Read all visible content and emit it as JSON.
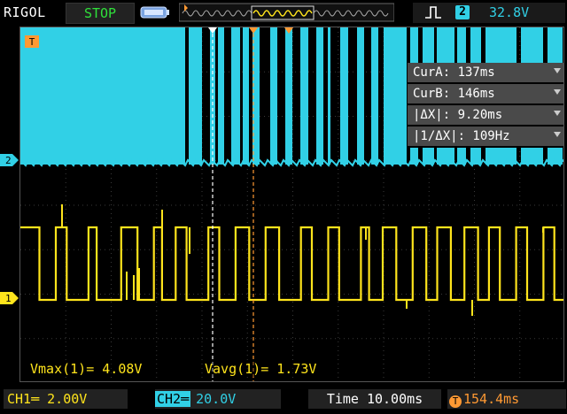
{
  "header": {
    "brand": "RIGOL",
    "run_state": "STOP",
    "trigger_source_channel": "2",
    "trigger_level": "32.8V"
  },
  "cursor_readout": {
    "cur_a": "CurA: 137ms",
    "cur_b": "CurB: 146ms",
    "delta_x": "|ΔX|: 9.20ms",
    "inv_delta_x": "|1/ΔX|: 109Hz"
  },
  "measurements": {
    "vmax": "Vmax(1)= 4.08V",
    "vavg": "Vavg(1)= 1.73V"
  },
  "footer": {
    "ch1_scale": "CH1═  2.00V",
    "ch2_label": "CH2═",
    "ch2_scale": "20.0V",
    "timebase": "Time 10.00ms",
    "trigger_offset": "154.4ms"
  },
  "markers": {
    "ch1": "1",
    "ch2": "2",
    "trigger": "T"
  },
  "chart_data": {
    "type": "line",
    "series": [
      {
        "name": "CH1",
        "color": "#ffe41c",
        "scale_per_div": "2.00V",
        "edges_ms": [
          0,
          7,
          13,
          17,
          25,
          28,
          37,
          43,
          49,
          52,
          57,
          61,
          69,
          73,
          79,
          84,
          90,
          95,
          103,
          107,
          113,
          117,
          125,
          128,
          133,
          138,
          144,
          149,
          153,
          158,
          163,
          168,
          172,
          176,
          182,
          186,
          192,
          196,
          200
        ]
      },
      {
        "name": "CH2",
        "color": "#31d0e6",
        "scale_per_div": "20.0V"
      }
    ],
    "colors": {
      "ch1": "#ffe41c",
      "ch2": "#31d0e6",
      "cursor_a": "#ffffff",
      "cursor_b": "#ff9933",
      "grid": "#3a3a3a"
    }
  }
}
